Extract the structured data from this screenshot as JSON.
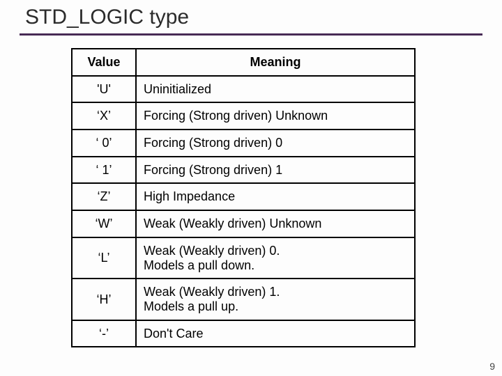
{
  "title": "STD_LOGIC type",
  "table": {
    "headers": {
      "value": "Value",
      "meaning": "Meaning"
    },
    "rows": [
      {
        "value": "'U'",
        "meaning": "Uninitialized"
      },
      {
        "value": "‘X’",
        "meaning": "Forcing (Strong driven) Unknown"
      },
      {
        "value": "‘ 0’",
        "meaning": "Forcing (Strong driven) 0"
      },
      {
        "value": "‘ 1’",
        "meaning": "Forcing (Strong driven) 1"
      },
      {
        "value": "‘Z’",
        "meaning": "High Impedance"
      },
      {
        "value": "‘W’",
        "meaning": "Weak (Weakly driven) Unknown"
      },
      {
        "value": "‘L’",
        "meaning": "Weak (Weakly driven) 0.\nModels a pull down."
      },
      {
        "value": "‘H’",
        "meaning": "Weak (Weakly driven) 1.\nModels a pull up."
      },
      {
        "value": "‘-’",
        "meaning": "Don't Care"
      }
    ]
  },
  "page_number": "9"
}
